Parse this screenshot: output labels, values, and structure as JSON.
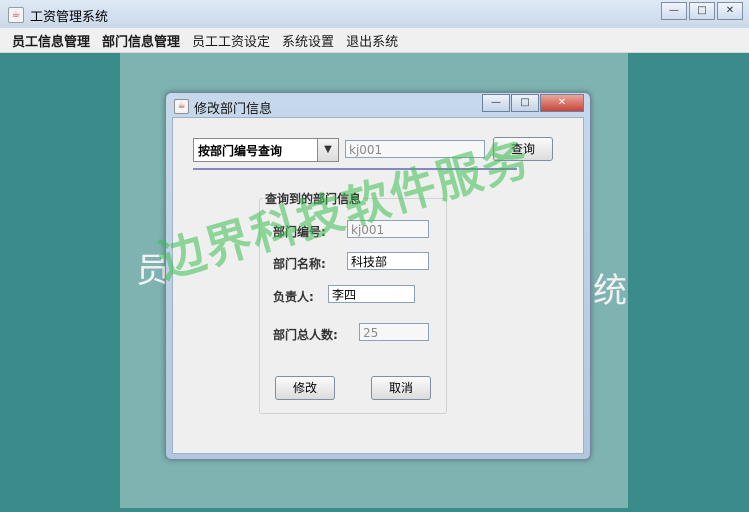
{
  "window": {
    "title": "工资管理系统",
    "buttons": [
      "—",
      "□",
      "✕"
    ]
  },
  "menubar": {
    "items": [
      "员工信息管理",
      "部门信息管理",
      "员工工资设定",
      "系统设置",
      "退出系统"
    ]
  },
  "background": {
    "left_char": "员",
    "right_char": "统"
  },
  "dialog": {
    "title": "修改部门信息",
    "buttons": [
      "—",
      "□",
      "✕"
    ],
    "query_type": "按部门编号查询",
    "query_value": "kj001",
    "query_button": "查询",
    "group_title": "查询到的部门信息",
    "fields": {
      "dept_no": {
        "label": "部门编号:",
        "value": "kj001"
      },
      "dept_name": {
        "label": "部门名称:",
        "value": "科技部"
      },
      "manager": {
        "label": "负责人:",
        "value": "李四"
      },
      "total": {
        "label": "部门总人数:",
        "value": "25"
      }
    },
    "modify_button": "修改",
    "cancel_button": "取消"
  },
  "watermark": "边界科技软件服务"
}
